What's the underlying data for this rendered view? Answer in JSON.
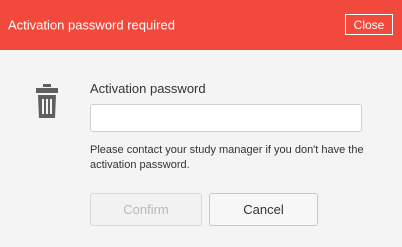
{
  "dialog": {
    "title": "Activation password required",
    "close_label": "Close",
    "field_label": "Activation password",
    "password_value": "",
    "password_placeholder": "",
    "help_text": "Please contact your study manager if you don't have the activation password.",
    "confirm_label": "Confirm",
    "cancel_label": "Cancel",
    "icon": "trash-icon"
  },
  "colors": {
    "header_bg": "#f14a3d",
    "body_bg": "#f4f4f4",
    "icon": "#5f5f5f",
    "text": "#333333",
    "disabled_text": "#b9b9b9"
  }
}
